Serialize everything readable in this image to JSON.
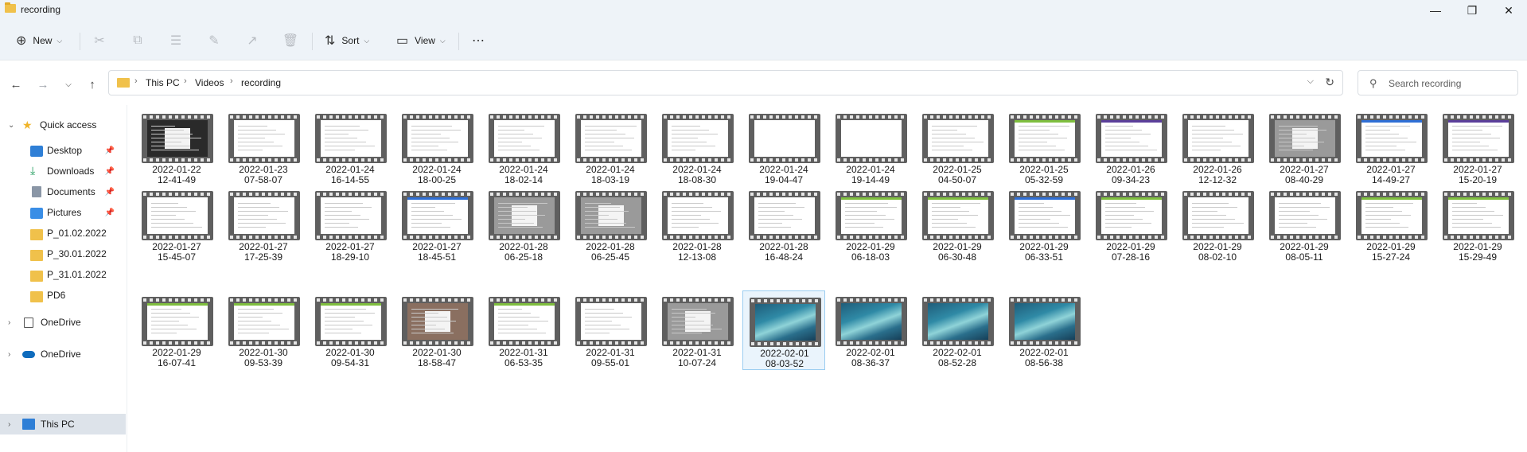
{
  "window": {
    "title": "recording",
    "minimize_icon": "minimize-icon",
    "maximize_icon": "restore-icon",
    "close_icon": "close-icon"
  },
  "toolbar": {
    "new_label": "New",
    "sort_label": "Sort",
    "view_label": "View",
    "icons": [
      "cut-icon",
      "copy-icon",
      "paste-icon",
      "rename-icon",
      "share-icon",
      "delete-icon",
      "more-icon"
    ]
  },
  "address": {
    "crumbs": [
      "This PC",
      "Videos",
      "recording"
    ]
  },
  "search": {
    "placeholder": "Search recording"
  },
  "sidebar": {
    "items": [
      {
        "label": "Quick access"
      },
      {
        "label": "Desktop"
      },
      {
        "label": "Downloads"
      },
      {
        "label": "Documents"
      },
      {
        "label": "Pictures"
      },
      {
        "label": "P_01.02.2022"
      },
      {
        "label": "P_30.01.2022"
      },
      {
        "label": "P_31.01.2022"
      },
      {
        "label": "PD6"
      },
      {
        "label": "OneDrive"
      },
      {
        "label": "OneDrive"
      },
      {
        "label": "This PC"
      }
    ]
  },
  "files": [
    {
      "date": "2022-01-22",
      "time": "12-41-49",
      "style": "dark"
    },
    {
      "date": "2022-01-23",
      "time": "07-58-07",
      "style": "doc"
    },
    {
      "date": "2022-01-24",
      "time": "16-14-55",
      "style": "doc"
    },
    {
      "date": "2022-01-24",
      "time": "18-00-25",
      "style": "doc"
    },
    {
      "date": "2022-01-24",
      "time": "18-02-14",
      "style": "doc"
    },
    {
      "date": "2022-01-24",
      "time": "18-03-19",
      "style": "doc"
    },
    {
      "date": "2022-01-24",
      "time": "18-08-30",
      "style": "doc"
    },
    {
      "date": "2022-01-24",
      "time": "19-04-47",
      "style": "blank"
    },
    {
      "date": "2022-01-24",
      "time": "19-14-49",
      "style": "blank"
    },
    {
      "date": "2022-01-25",
      "time": "04-50-07",
      "style": "doc"
    },
    {
      "date": "2022-01-25",
      "time": "05-32-59",
      "style": "green"
    },
    {
      "date": "2022-01-26",
      "time": "09-34-23",
      "style": "purple"
    },
    {
      "date": "2022-01-26",
      "time": "12-12-32",
      "style": "doc"
    },
    {
      "date": "2022-01-27",
      "time": "08-40-29",
      "style": "gray"
    },
    {
      "date": "2022-01-27",
      "time": "14-49-27",
      "style": "blue"
    },
    {
      "date": "2022-01-27",
      "time": "15-20-19",
      "style": "purple"
    },
    {
      "date": "2022-01-27",
      "time": "15-45-07",
      "style": "doc"
    },
    {
      "date": "2022-01-27",
      "time": "17-25-39",
      "style": "doc"
    },
    {
      "date": "2022-01-27",
      "time": "18-29-10",
      "style": "doc"
    },
    {
      "date": "2022-01-27",
      "time": "18-45-51",
      "style": "blue"
    },
    {
      "date": "2022-01-28",
      "time": "06-25-18",
      "style": "gray"
    },
    {
      "date": "2022-01-28",
      "time": "06-25-45",
      "style": "gray"
    },
    {
      "date": "2022-01-28",
      "time": "12-13-08",
      "style": "doc"
    },
    {
      "date": "2022-01-28",
      "time": "16-48-24",
      "style": "doc"
    },
    {
      "date": "2022-01-29",
      "time": "06-18-03",
      "style": "green"
    },
    {
      "date": "2022-01-29",
      "time": "06-30-48",
      "style": "green"
    },
    {
      "date": "2022-01-29",
      "time": "06-33-51",
      "style": "blue"
    },
    {
      "date": "2022-01-29",
      "time": "07-28-16",
      "style": "green"
    },
    {
      "date": "2022-01-29",
      "time": "08-02-10",
      "style": "doc"
    },
    {
      "date": "2022-01-29",
      "time": "08-05-11",
      "style": "doc"
    },
    {
      "date": "2022-01-29",
      "time": "15-27-24",
      "style": "green"
    },
    {
      "date": "2022-01-29",
      "time": "15-29-49",
      "style": "green"
    },
    {
      "date": "2022-01-29",
      "time": "16-07-41",
      "style": "green"
    },
    {
      "date": "2022-01-30",
      "time": "09-53-39",
      "style": "green"
    },
    {
      "date": "2022-01-30",
      "time": "09-54-31",
      "style": "green"
    },
    {
      "date": "2022-01-30",
      "time": "18-58-47",
      "style": "brown"
    },
    {
      "date": "2022-01-31",
      "time": "06-53-35",
      "style": "green"
    },
    {
      "date": "2022-01-31",
      "time": "09-55-01",
      "style": "doc"
    },
    {
      "date": "2022-01-31",
      "time": "10-07-24",
      "style": "gray"
    },
    {
      "date": "2022-02-01",
      "time": "08-03-52",
      "style": "sea",
      "selected": true
    },
    {
      "date": "2022-02-01",
      "time": "08-36-37",
      "style": "sea"
    },
    {
      "date": "2022-02-01",
      "time": "08-52-28",
      "style": "sea"
    },
    {
      "date": "2022-02-01",
      "time": "08-56-38",
      "style": "sea"
    }
  ]
}
